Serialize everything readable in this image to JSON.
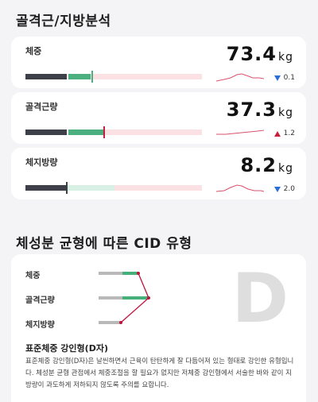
{
  "section1": {
    "title": "골격근/지방분석"
  },
  "cards": [
    {
      "label": "체중",
      "value": "73.4",
      "unit": "kg",
      "delta": "0.1",
      "direction": "down",
      "level": 0.38
    },
    {
      "label": "골격근량",
      "value": "37.3",
      "unit": "kg",
      "delta": "1.2",
      "direction": "up",
      "level": 0.44
    },
    {
      "label": "체지방량",
      "value": "8.2",
      "unit": "kg",
      "delta": "2.0",
      "direction": "down",
      "level": 0.23
    }
  ],
  "section2": {
    "title": "체성분 균형에 따른 CID 유형"
  },
  "cid": {
    "labels": [
      "체중",
      "골격근량",
      "체지방량"
    ],
    "letter": "D",
    "type_title": "표준체중 강인형(D자)",
    "description": "표준체중 강인형(D자)은 날씬하면서 근육이 탄탄하게 잘 다듬어져 있는 형태로 강인한 유형입니다. 체성분 균형 관점에서 체중조절을 할 필요가 없지만 저체중 강인형에서 서술한 바와 같이 지방량이 과도하게 저하되지 않도록 주의를 요합니다.",
    "colors": {
      "gray": "#b9b9b9",
      "green": "#45b07a",
      "red": "#c0143c"
    }
  },
  "colors": {
    "dark": "#3d4048",
    "green": "#4caf7f",
    "pink": "#fbe0e4",
    "paleGreen": "#d8efe3",
    "red": "#c8203c",
    "blue": "#2b6fd6"
  }
}
